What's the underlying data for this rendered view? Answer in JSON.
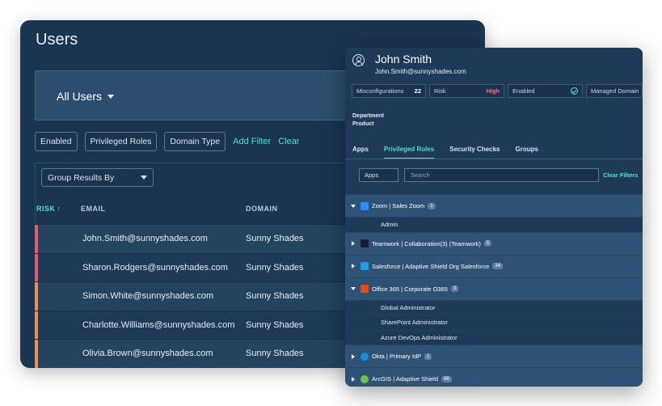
{
  "users_panel": {
    "title": "Users",
    "all_users_label": "All Users",
    "filters": [
      "Enabled",
      "Privileged Roles",
      "Domain Type"
    ],
    "add_filter": "Add Filter",
    "clear": "Clear",
    "group_results_by": "Group Results By",
    "columns": {
      "risk": "RISK",
      "email": "EMAIL",
      "domain": "DOMAIN"
    },
    "rows": [
      {
        "email": "John.Smith@sunnyshades.com",
        "domain": "Sunny Shades",
        "risk_color": "#e35d72"
      },
      {
        "email": "Sharon.Rodgers@sunnyshades.com",
        "domain": "Sunny Shades",
        "risk_color": "#e35d72"
      },
      {
        "email": "Simon.White@sunnyshades.com",
        "domain": "Sunny Shades",
        "risk_color": "#e8915a"
      },
      {
        "email": "Charlotte.Williams@sunnyshades.com",
        "domain": "Sunny Shades",
        "risk_color": "#e8915a"
      },
      {
        "email": "Olivia.Brown@sunnyshades.com",
        "domain": "Sunny Shades",
        "risk_color": "#e8915a"
      }
    ]
  },
  "detail_panel": {
    "name": "John Smith",
    "email": "John.Smith@sunnyshades.com",
    "stats": {
      "misconfigurations_label": "Misconfigurations",
      "misconfigurations_value": "22",
      "risk_label": "Risk",
      "risk_value": "High",
      "enabled_label": "Enabled",
      "managed_domain_label": "Managed Domain"
    },
    "department_label": "Department",
    "product_label": "Product",
    "tabs": [
      "Apps",
      "Privileged Roles",
      "Security Checks",
      "Groups"
    ],
    "apps_select": "Apps",
    "search_placeholder": "Search",
    "clear_filters": "Clear Filters",
    "apps": [
      {
        "name": "Zoom | Sales Zoom",
        "count": "1",
        "expanded": true,
        "logo": "zoom-logo-icon",
        "color": "#2d8cff",
        "roles": [
          "Admin"
        ]
      },
      {
        "name": "Teamwork | Collaboration(3) (Teamwork)",
        "count": "5",
        "expanded": false,
        "logo": "teamwork-logo-icon",
        "color": "#1b1b2e",
        "roles": []
      },
      {
        "name": "Salesforce | Adaptive Shield Org Salesforce",
        "count": "34",
        "expanded": false,
        "logo": "salesforce-logo-icon",
        "color": "#1ba0e1",
        "roles": []
      },
      {
        "name": "Office 365 | Corporate O365",
        "count": "3",
        "expanded": true,
        "logo": "office365-logo-icon",
        "color": "#e64a19",
        "roles": [
          "Global Administrator",
          "SharePoint Administrator",
          "Azure DevOps Administrator"
        ]
      },
      {
        "name": "Okta | Primary IdP",
        "count": "1",
        "expanded": false,
        "logo": "okta-logo-icon",
        "color": "#1a8cd8",
        "roles": []
      },
      {
        "name": "ArcGIS | Adaptive Shield",
        "count": "88",
        "expanded": false,
        "logo": "arcgis-logo-icon",
        "color": "#6cc24a",
        "roles": []
      }
    ]
  }
}
